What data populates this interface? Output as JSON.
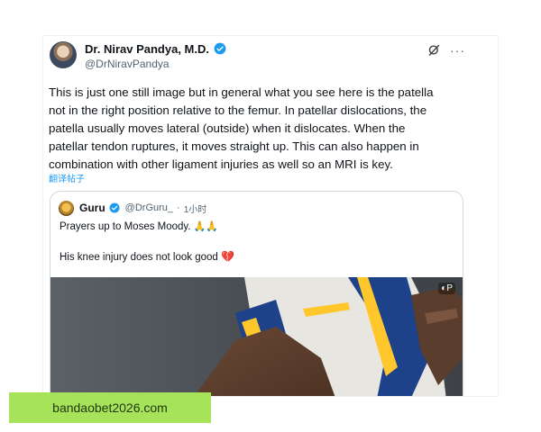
{
  "tweet": {
    "author_name": "Dr. Nirav Pandya, M.D.",
    "author_handle": "@DrNiravPandya",
    "more_icon": "···",
    "body_lines": [
      "This is just one still image but in general what you see here is the patella",
      "not in the right position relative to the femur. In patellar dislocations, the",
      "patella usually moves lateral (outside) when it dislocates.  When the",
      "patellar tendon ruptures, it moves straight up.  This can also happen in",
      "combination with other ligament injuries as well so an MRI is key."
    ],
    "translate_label": "翻译帖子"
  },
  "quote": {
    "author_name": "Guru",
    "author_handle": "@DrGuru_",
    "separator": "·",
    "time": "1小时",
    "line1": "Prayers up to Moses Moody.",
    "line1_emoji": "🙏🙏",
    "line2": "His knee injury does not look good",
    "line2_emoji": "💔",
    "media_badge": "◐P"
  },
  "watermark": {
    "text": "bandaobet2026.com"
  },
  "colors": {
    "verified": "#1d9bf0",
    "watermark_bg": "#a6e35b",
    "jersey_blue": "#1d428a",
    "jersey_gold": "#ffc72c"
  },
  "icons": {
    "author_avatar": "avatar",
    "verified": "verified-badge-icon",
    "grok": "grok-icon",
    "more": "more-icon",
    "quote_avatar": "avatar"
  }
}
